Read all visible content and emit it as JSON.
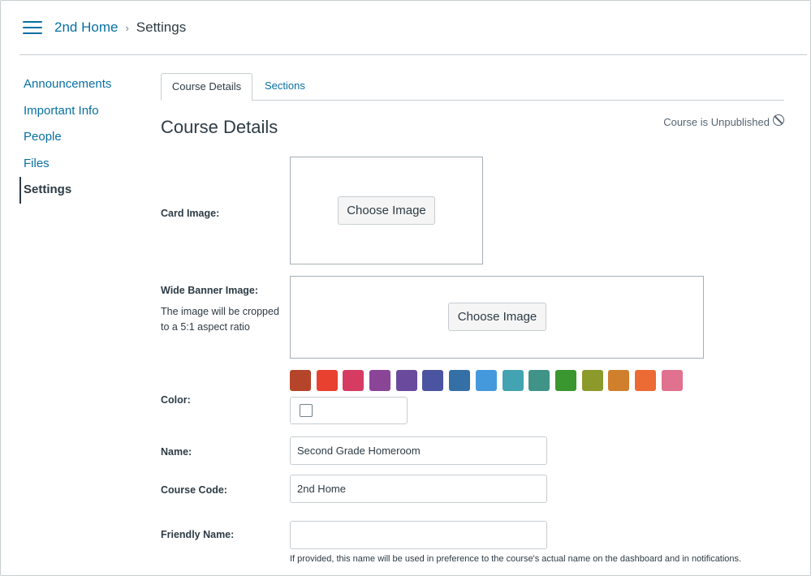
{
  "header": {
    "breadcrumb_course": "2nd Home",
    "breadcrumb_separator": "›",
    "breadcrumb_current": "Settings"
  },
  "sidebar": {
    "items": [
      {
        "label": "Announcements",
        "active": false
      },
      {
        "label": "Important Info",
        "active": false
      },
      {
        "label": "People",
        "active": false
      },
      {
        "label": "Files",
        "active": false
      },
      {
        "label": "Settings",
        "active": true
      }
    ]
  },
  "tabs": [
    {
      "label": "Course Details",
      "active": true
    },
    {
      "label": "Sections",
      "active": false
    }
  ],
  "main": {
    "title": "Course Details",
    "publish_status": "Course is Unpublished",
    "card_image": {
      "label": "Card Image:",
      "button": "Choose Image"
    },
    "banner_image": {
      "label": "Wide Banner Image:",
      "hint": "The image will be cropped to a 5:1 aspect ratio",
      "button": "Choose Image"
    },
    "color": {
      "label": "Color:",
      "swatches": [
        "#b5452a",
        "#e8412f",
        "#d63b62",
        "#8b4597",
        "#6a4a9d",
        "#4a54a1",
        "#346fa6",
        "#4499dd",
        "#43a3b3",
        "#409387",
        "#3a962f",
        "#8c9a2c",
        "#d07f2c",
        "#ec6a34",
        "#e0718f"
      ]
    },
    "name": {
      "label": "Name:",
      "value": "Second Grade Homeroom"
    },
    "course_code": {
      "label": "Course Code:",
      "value": "2nd Home"
    },
    "friendly_name": {
      "label": "Friendly Name:",
      "value": "",
      "help": "If provided, this name will be used in preference to the course's actual name on the dashboard and in notifications."
    }
  },
  "colors": {
    "link": "#0770a3",
    "text": "#2d3b45",
    "border": "#c7cdd1"
  }
}
